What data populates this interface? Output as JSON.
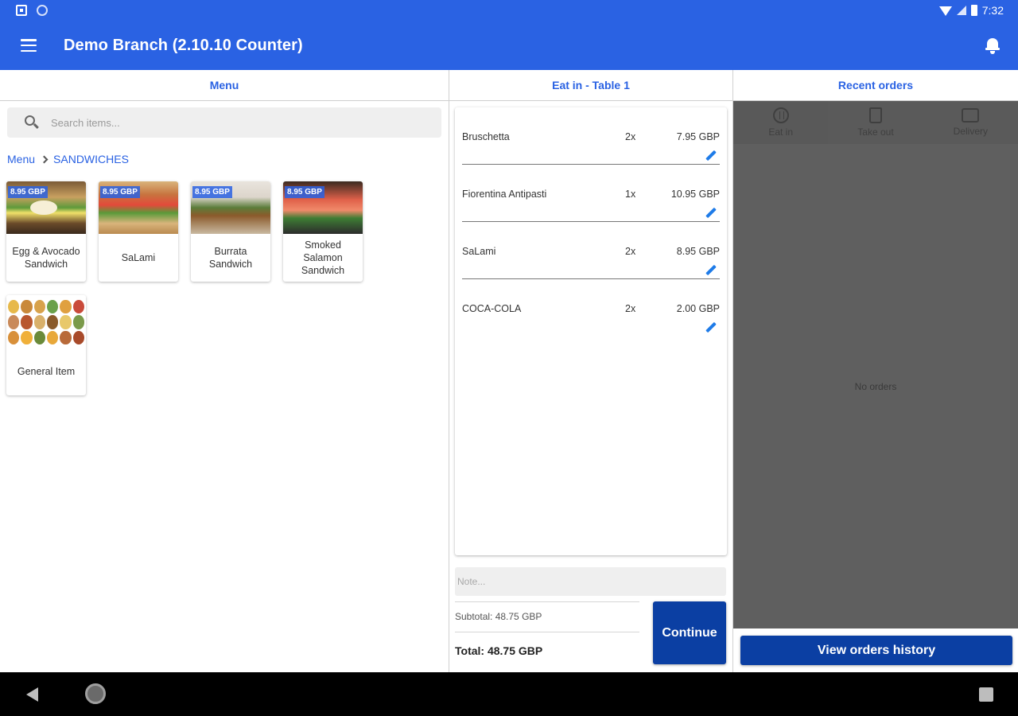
{
  "status_bar": {
    "time": "7:32"
  },
  "app_bar": {
    "title": "Demo Branch (2.10.10 Counter)"
  },
  "menu_panel": {
    "header": "Menu",
    "search": {
      "placeholder": "Search items...",
      "value": ""
    },
    "breadcrumb": {
      "root": "Menu",
      "current": "SANDWICHES"
    },
    "items": [
      {
        "name": "Egg & Avocado Sandwich",
        "price": "8.95 GBP"
      },
      {
        "name": "SaLami",
        "price": "8.95 GBP"
      },
      {
        "name": "Burrata Sandwich",
        "price": "8.95 GBP"
      },
      {
        "name": "Smoked Salamon Sandwich",
        "price": "8.95 GBP"
      },
      {
        "name": "General Item",
        "price": ""
      }
    ]
  },
  "order_panel": {
    "header": "Eat in - Table 1",
    "lines": [
      {
        "name": "Bruschetta",
        "qty": "2x",
        "price": "7.95 GBP"
      },
      {
        "name": "Fiorentina Antipasti",
        "qty": "1x",
        "price": "10.95 GBP"
      },
      {
        "name": "SaLami",
        "qty": "2x",
        "price": "8.95 GBP"
      },
      {
        "name": "COCA-COLA",
        "qty": "2x",
        "price": "2.00 GBP"
      }
    ],
    "note": {
      "placeholder": "Note...",
      "value": ""
    },
    "subtotal": "Subtotal: 48.75 GBP",
    "total": "Total: 48.75 GBP",
    "continue_label": "Continue"
  },
  "recent_panel": {
    "header": "Recent orders",
    "tabs": [
      {
        "label": "Eat in",
        "icon": "dine-in-icon"
      },
      {
        "label": "Take out",
        "icon": "takeout-bag-icon"
      },
      {
        "label": "Delivery",
        "icon": "delivery-icon"
      }
    ],
    "empty_text": "No orders",
    "history_label": "View orders history"
  },
  "colors": {
    "primary": "#2a62e3",
    "button": "#0b3fa3",
    "overlay": "#5f5f5f"
  }
}
